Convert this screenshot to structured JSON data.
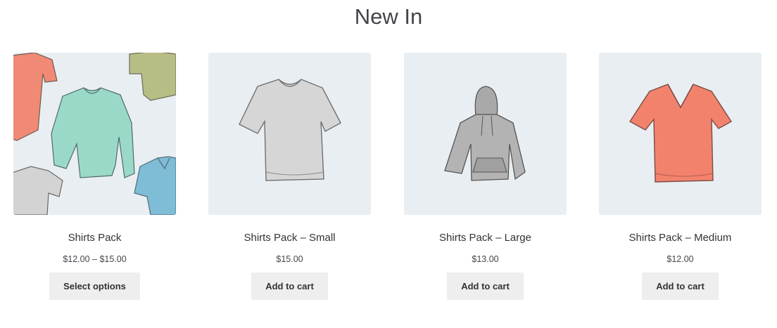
{
  "section": {
    "title": "New In"
  },
  "products": [
    {
      "title": "Shirts Pack",
      "price": "$12.00 – $15.00",
      "button_label": "Select options",
      "image_icon": "shirts-pack-illustration"
    },
    {
      "title": "Shirts Pack – Small",
      "price": "$15.00",
      "button_label": "Add to cart",
      "image_icon": "grey-tshirt-illustration"
    },
    {
      "title": "Shirts Pack – Large",
      "price": "$13.00",
      "button_label": "Add to cart",
      "image_icon": "grey-hoodie-illustration"
    },
    {
      "title": "Shirts Pack – Medium",
      "price": "$12.00",
      "button_label": "Add to cart",
      "image_icon": "coral-vneck-tshirt-illustration"
    }
  ],
  "colors": {
    "image_background": "#e9eef2",
    "button_background": "#eeeeee",
    "text": "#333333"
  }
}
